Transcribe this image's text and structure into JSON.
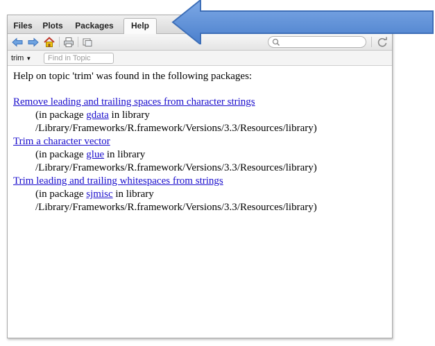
{
  "tabs": [
    {
      "label": "Files",
      "active": false
    },
    {
      "label": "Plots",
      "active": false
    },
    {
      "label": "Packages",
      "active": false
    },
    {
      "label": "Help",
      "active": true
    }
  ],
  "toolbar": {
    "icons": [
      "back-arrow-icon",
      "forward-arrow-icon",
      "home-icon",
      "print-icon",
      "new-window-icon",
      "search-icon",
      "refresh-icon"
    ],
    "search_value": ""
  },
  "findbar": {
    "topic": "trim",
    "find_placeholder": "Find in Topic"
  },
  "content": {
    "heading": "Help on topic 'trim' was found in the following packages:",
    "entries": [
      {
        "title": "Remove leading and trailing spaces from character strings",
        "pkg_prefix": "(in package ",
        "pkg": "gdata",
        "pkg_suffix": " in library",
        "path": "/Library/Frameworks/R.framework/Versions/3.3/Resources/library)"
      },
      {
        "title": "Trim a character vector",
        "pkg_prefix": "(in package ",
        "pkg": "glue",
        "pkg_suffix": " in library",
        "path": "/Library/Frameworks/R.framework/Versions/3.3/Resources/library)"
      },
      {
        "title": "Trim leading and trailing whitespaces from strings",
        "pkg_prefix": "(in package ",
        "pkg": "sjmisc",
        "pkg_suffix": " in library",
        "path": "/Library/Frameworks/R.framework/Versions/3.3/Resources/library)"
      }
    ]
  },
  "colors": {
    "link": "#1a0dcc",
    "arrow_fill": "#5b8fd6",
    "arrow_stroke": "#3e6fb8"
  }
}
